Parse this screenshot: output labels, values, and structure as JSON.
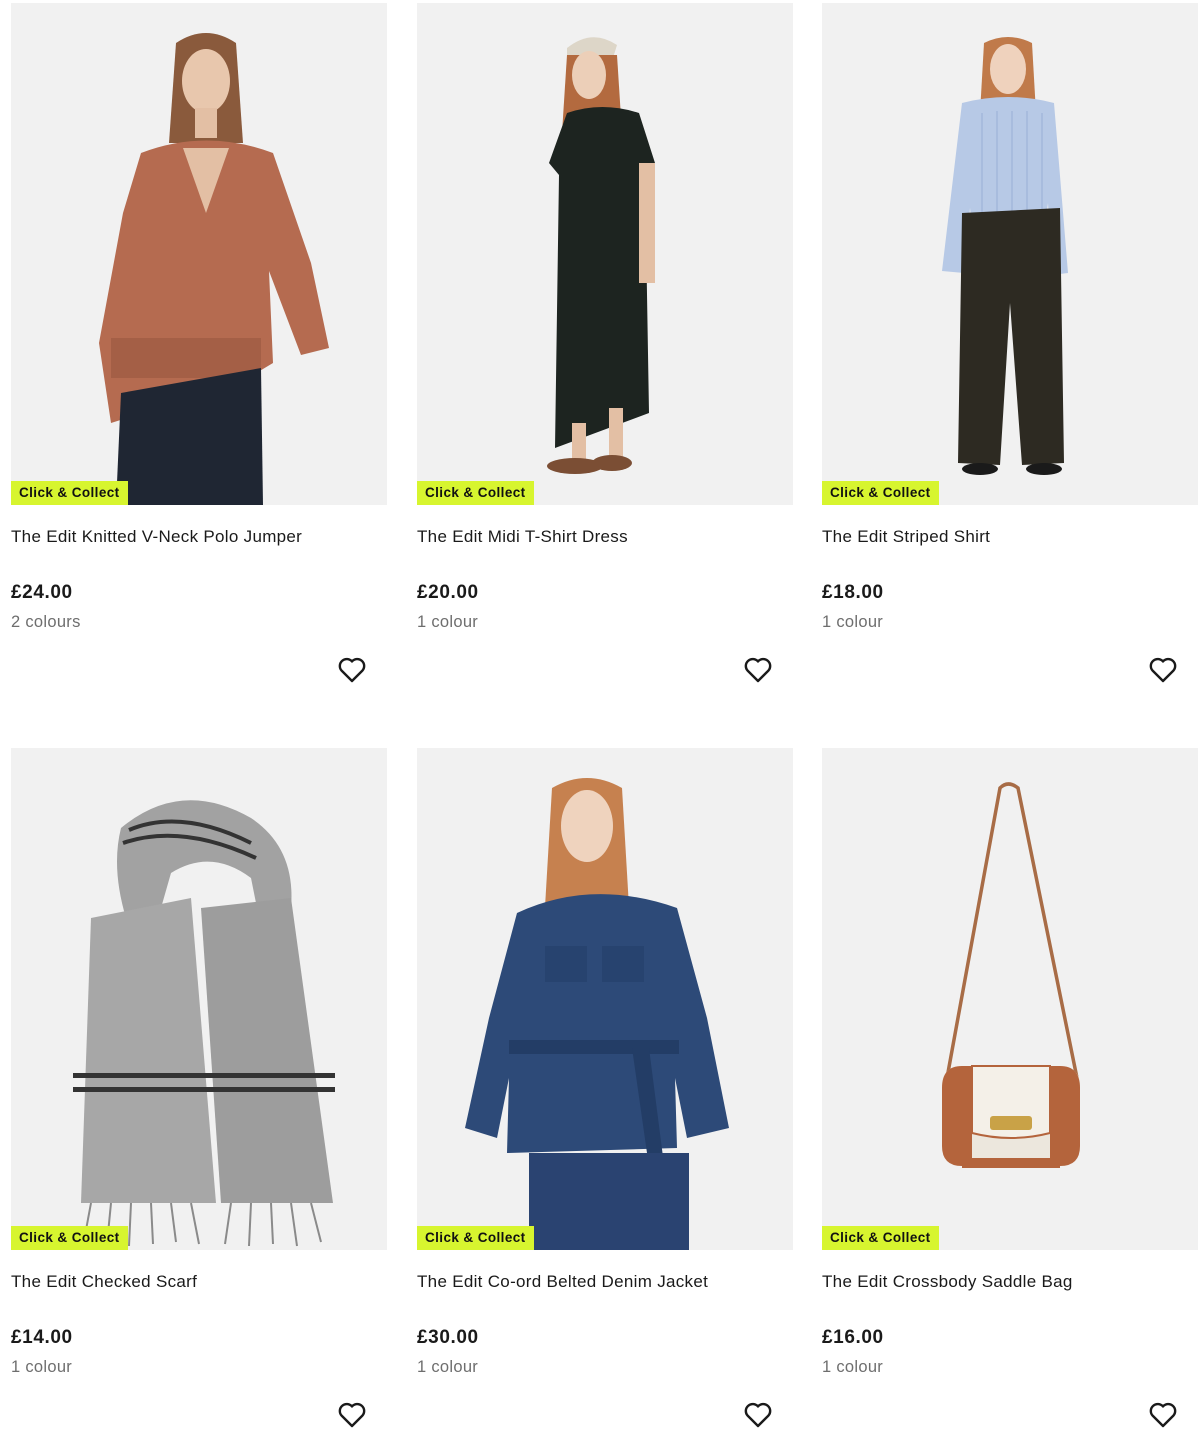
{
  "theme": {
    "badge_color": "#d7f52f",
    "image_bg": "#f1f1f1",
    "text_color": "#1a1a1a",
    "muted_color": "#6e6e6e"
  },
  "products": [
    {
      "badge": "Click & Collect",
      "name": "The Edit Knitted V-Neck Polo Jumper",
      "price": "£24.00",
      "colours": "2 colours",
      "icon": "heart-outline-icon"
    },
    {
      "badge": "Click & Collect",
      "name": "The Edit Midi T-Shirt Dress",
      "price": "£20.00",
      "colours": "1 colour",
      "icon": "heart-outline-icon"
    },
    {
      "badge": "Click & Collect",
      "name": "The Edit Striped Shirt",
      "price": "£18.00",
      "colours": "1 colour",
      "icon": "heart-outline-icon"
    },
    {
      "badge": "Click & Collect",
      "name": "The Edit Checked Scarf",
      "price": "£14.00",
      "colours": "1 colour",
      "icon": "heart-outline-icon"
    },
    {
      "badge": "Click & Collect",
      "name": "The Edit Co-ord Belted Denim Jacket",
      "price": "£30.00",
      "colours": "1 colour",
      "icon": "heart-outline-icon"
    },
    {
      "badge": "Click & Collect",
      "name": "The Edit Crossbody Saddle Bag",
      "price": "£16.00",
      "colours": "1 colour",
      "icon": "heart-outline-icon"
    }
  ]
}
